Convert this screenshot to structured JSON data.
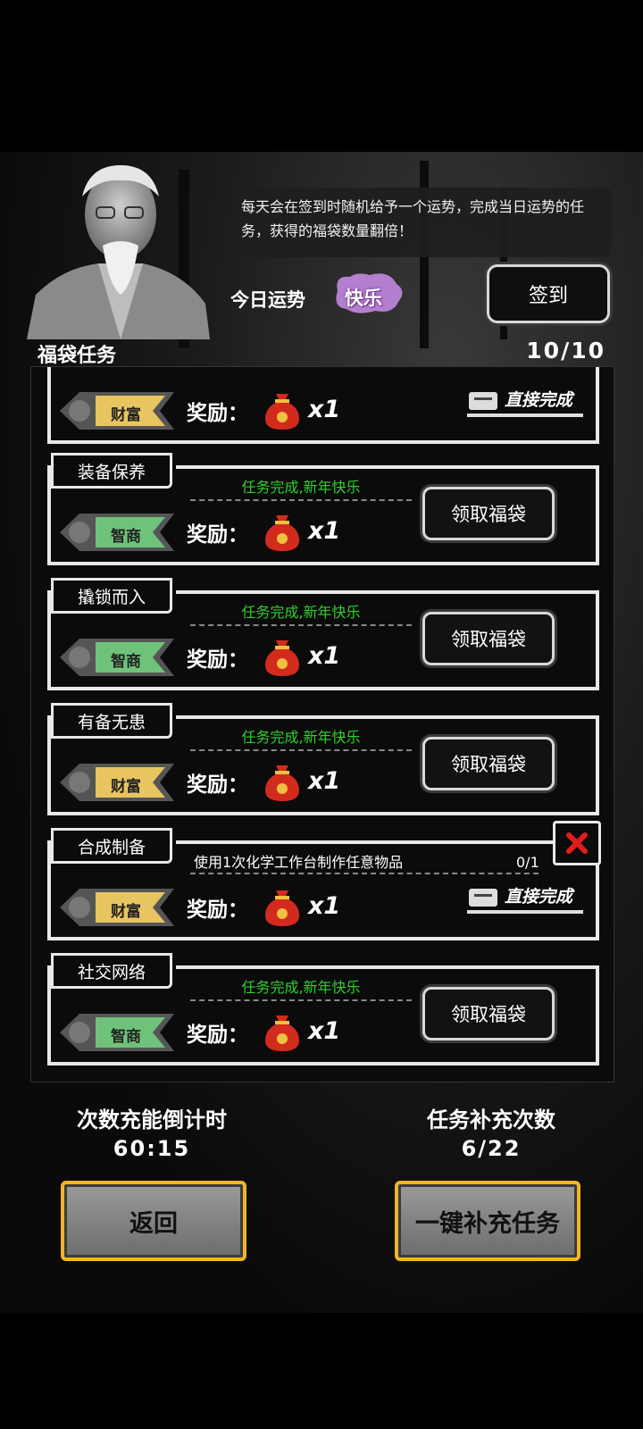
{
  "header": {
    "info_text": "每天会在签到时随机给予一个运势，完成当日运势的任务，获得的福袋数量翻倍！",
    "fortune_label": "今日运势",
    "fortune_value": "快乐",
    "sign_button": "签到"
  },
  "section": {
    "title": "福袋任务",
    "count": "10/10"
  },
  "tasks": [
    {
      "tag": "财富",
      "reward_label": "奖励：",
      "reward_qty": "x1",
      "action": "直接完成"
    },
    {
      "title": "装备保养",
      "status": "任务完成,新年快乐",
      "tag": "智商",
      "reward_label": "奖励：",
      "reward_qty": "x1",
      "action": "领取福袋"
    },
    {
      "title": "撬锁而入",
      "status": "任务完成,新年快乐",
      "tag": "智商",
      "reward_label": "奖励：",
      "reward_qty": "x1",
      "action": "领取福袋"
    },
    {
      "title": "有备无患",
      "status": "任务完成,新年快乐",
      "tag": "财富",
      "reward_label": "奖励：",
      "reward_qty": "x1",
      "action": "领取福袋"
    },
    {
      "title": "合成制备",
      "status": "使用1次化学工作台制作任意物品",
      "progress": "0/1",
      "tag": "财富",
      "reward_label": "奖励：",
      "reward_qty": "x1",
      "action": "直接完成"
    },
    {
      "title": "社交网络",
      "status": "任务完成,新年快乐",
      "tag": "智商",
      "reward_label": "奖励：",
      "reward_qty": "x1",
      "action": "领取福袋"
    }
  ],
  "footer": {
    "countdown_label": "次数充能倒计时",
    "countdown_value": "60:15",
    "refill_label": "任务补充次数",
    "refill_value": "6/22",
    "back_button": "返回",
    "refill_button": "一键补充任务"
  },
  "colors": {
    "gold": "#f0b429",
    "green_status": "#2fd02f",
    "tag_wealth": "#e8c560",
    "tag_iq": "#6fc27a",
    "fortune": "#b57fd0"
  },
  "icons": {
    "lucky_bag": "lucky-bag-icon",
    "ticket": "ticket-icon",
    "cancel": "close-icon"
  }
}
